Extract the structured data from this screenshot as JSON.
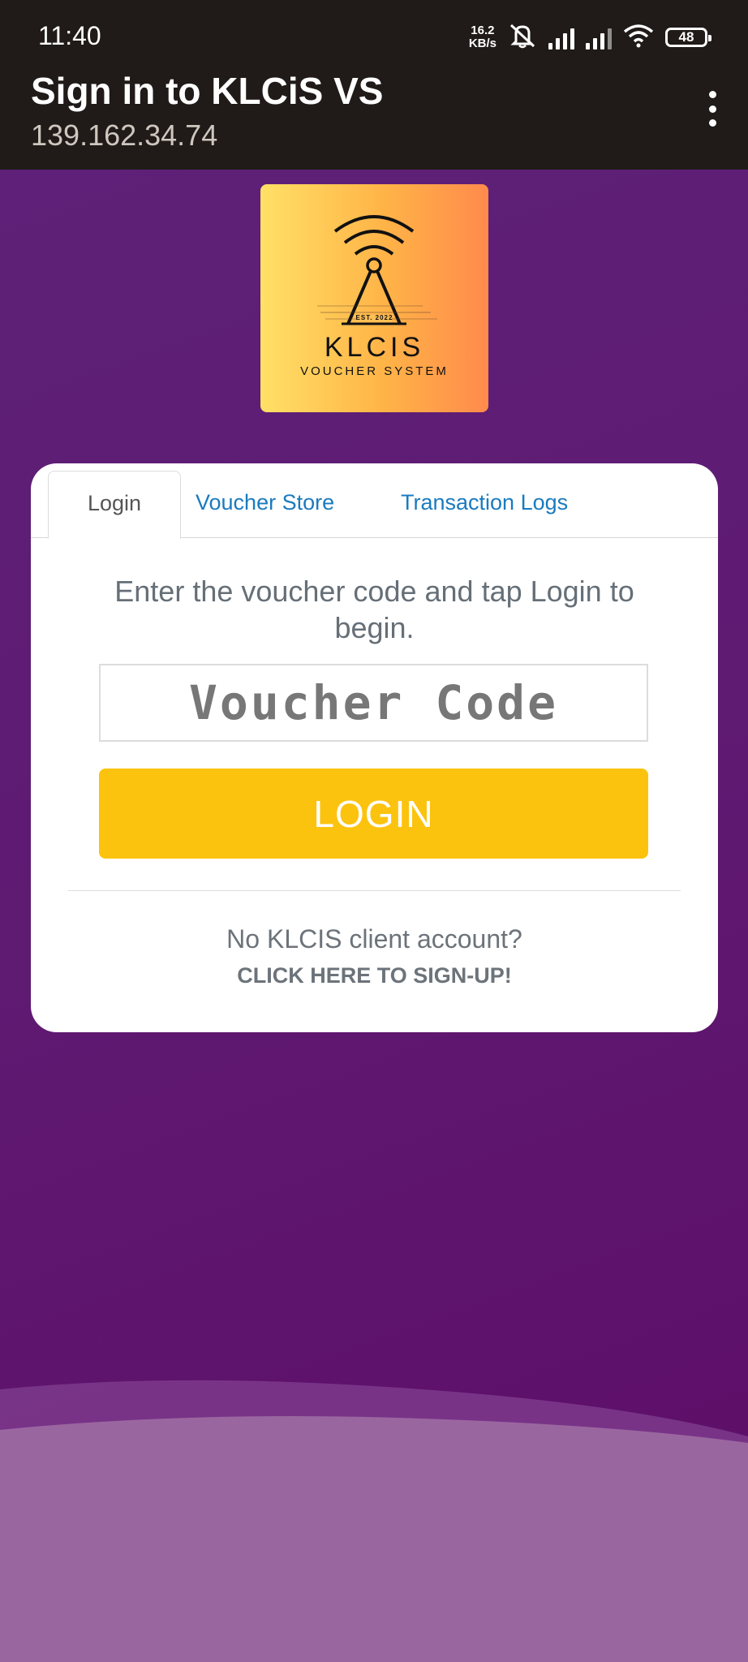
{
  "status_bar": {
    "time": "11:40",
    "network_speed_value": "16.2",
    "network_speed_unit": "KB/s",
    "battery": "48"
  },
  "app_bar": {
    "title": "Sign in to KLCiS VS",
    "subtitle": "139.162.34.74"
  },
  "logo": {
    "name": "KLCIS",
    "subtitle": "VOUCHER SYSTEM",
    "established": "EST. 2022"
  },
  "tabs": [
    {
      "label": "Login",
      "active": true
    },
    {
      "label": "Voucher Store",
      "active": false
    },
    {
      "label": "Transaction Logs",
      "active": false
    }
  ],
  "login": {
    "prompt": "Enter the voucher code and tap Login to begin.",
    "voucher_placeholder": "Voucher Code",
    "voucher_value": "",
    "button_label": "LOGIN",
    "no_account_text": "No KLCIS client account?",
    "signup_link": "CLICK HERE TO SIGN-UP!"
  },
  "colors": {
    "background": "#5e1a72",
    "app_bar": "#201b18",
    "login_button": "#fcc30e",
    "tab_link": "#1a7bbf"
  }
}
